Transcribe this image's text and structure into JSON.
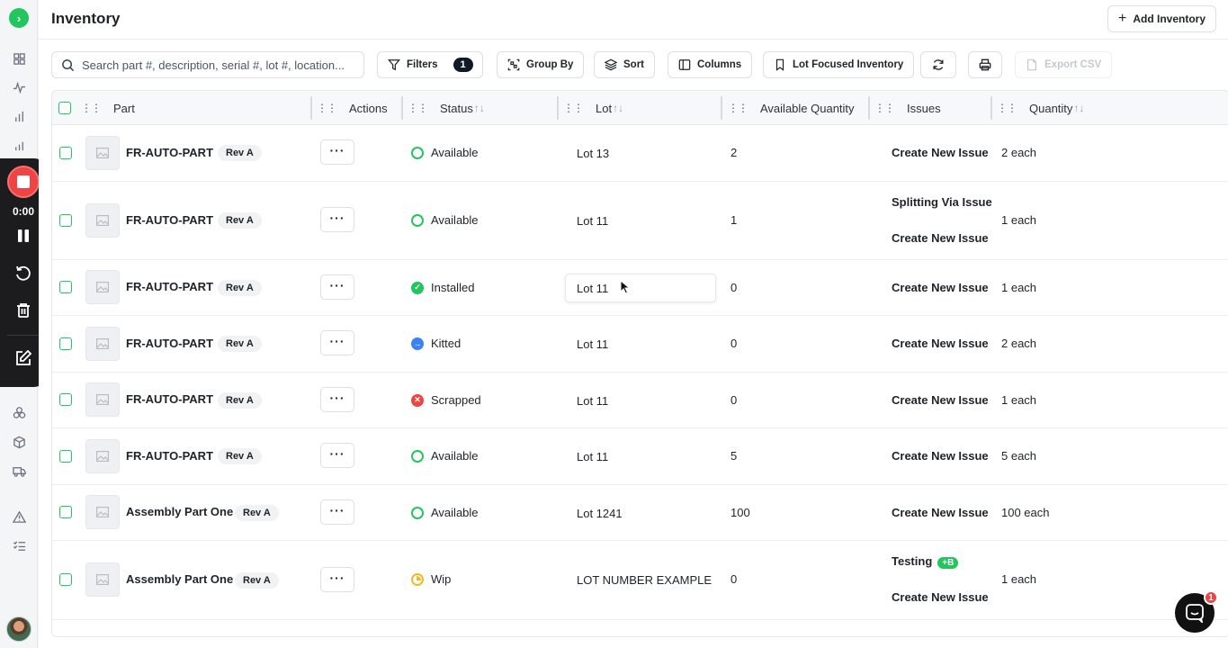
{
  "app": {
    "title": "Inventory",
    "add_label": "Add Inventory"
  },
  "recorder": {
    "time": "0:00"
  },
  "toolbar": {
    "search_placeholder": "Search part #, description, serial #, lot #, location...",
    "filters_label": "Filters",
    "filters_count": "1",
    "group_by_label": "Group By",
    "sort_label": "Sort",
    "columns_label": "Columns",
    "lot_focused_label": "Lot Focused Inventory",
    "export_label": "Export CSV"
  },
  "table": {
    "headers": {
      "part": "Part",
      "actions": "Actions",
      "status": "Status",
      "lot": "Lot",
      "available_quantity": "Available Quantity",
      "issues": "Issues",
      "quantity": "Quantity"
    },
    "sort_glyph": "↑↓",
    "rows": [
      {
        "part": "FR-AUTO-PART",
        "rev": "Rev A",
        "status": "Available",
        "lot": "Lot 13",
        "available": "2",
        "issues": [
          "Create New Issue"
        ],
        "quantity": "2 each"
      },
      {
        "part": "FR-AUTO-PART",
        "rev": "Rev A",
        "status": "Available",
        "lot": "Lot 11",
        "available": "1",
        "issues": [
          "Splitting Via Issue C",
          "Create New Issue"
        ],
        "quantity": "1 each"
      },
      {
        "part": "FR-AUTO-PART",
        "rev": "Rev A",
        "status": "Installed",
        "lot": "Lot 11",
        "available": "0",
        "issues": [
          "Create New Issue"
        ],
        "quantity": "1 each"
      },
      {
        "part": "FR-AUTO-PART",
        "rev": "Rev A",
        "status": "Kitted",
        "lot": "Lot 11",
        "available": "0",
        "issues": [
          "Create New Issue"
        ],
        "quantity": "2 each"
      },
      {
        "part": "FR-AUTO-PART",
        "rev": "Rev A",
        "status": "Scrapped",
        "lot": "Lot 11",
        "available": "0",
        "issues": [
          "Create New Issue"
        ],
        "quantity": "1 each"
      },
      {
        "part": "FR-AUTO-PART",
        "rev": "Rev A",
        "status": "Available",
        "lot": "Lot 11",
        "available": "5",
        "issues": [
          "Create New Issue"
        ],
        "quantity": "5 each"
      },
      {
        "part": "Assembly Part One",
        "rev": "Rev A",
        "status": "Available",
        "lot": "Lot 1241",
        "available": "100",
        "issues": [
          "Create New Issue"
        ],
        "quantity": "100 each"
      },
      {
        "part": "Assembly Part One",
        "rev": "Rev A",
        "status": "Wip",
        "lot": "LOT NUMBER EXAMPLE",
        "available": "0",
        "issues": [
          "Testing",
          "Create New Issue"
        ],
        "issue_tag": "+B",
        "quantity": "1 each"
      }
    ]
  },
  "chat": {
    "unread": "1"
  },
  "colors": {
    "accent": "#22c55e",
    "record": "#ef4444",
    "kitted": "#3b82f6",
    "wip": "#f5b821"
  }
}
